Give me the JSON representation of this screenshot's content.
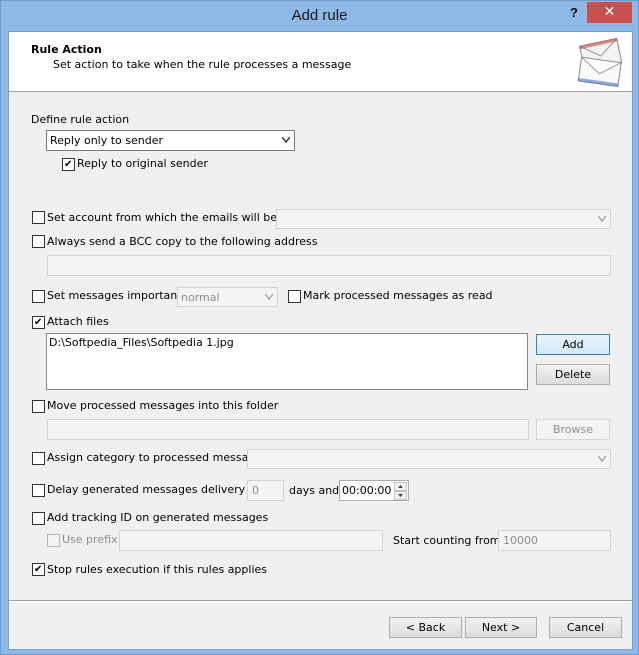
{
  "window": {
    "title": "Add rule",
    "help_label": "?",
    "close_label": "✕"
  },
  "header": {
    "title": "Rule Action",
    "subtitle": "Set action to take when the rule processes a message",
    "icon": "envelopes-icon"
  },
  "define_action": {
    "label": "Define rule action",
    "selected": "Reply only to sender",
    "reply_original": {
      "label": "Reply to original sender",
      "checked": true
    }
  },
  "set_account": {
    "label": "Set account from which the emails will be sent",
    "checked": false,
    "value": ""
  },
  "bcc": {
    "label": "Always send a BCC copy to the following address",
    "checked": false,
    "value": ""
  },
  "importance": {
    "label": "Set messages importance",
    "checked": false,
    "value": "normal"
  },
  "mark_read": {
    "label": "Mark processed messages as read",
    "checked": false
  },
  "attach": {
    "label": "Attach files",
    "checked": true,
    "files": [
      "D:\\Softpedia_Files\\Softpedia 1.jpg"
    ],
    "add_label": "Add",
    "delete_label": "Delete"
  },
  "move": {
    "label": "Move processed messages into this folder",
    "checked": false,
    "value": "",
    "browse_label": "Browse"
  },
  "category": {
    "label": "Assign category to processed messages",
    "checked": false,
    "value": ""
  },
  "delay": {
    "label": "Delay generated messages delivery with",
    "checked": false,
    "days": "0",
    "days_and_label": "days and",
    "time": "00:00:00"
  },
  "tracking": {
    "label": "Add tracking ID on generated messages",
    "checked": false,
    "use_prefix_label": "Use prefix",
    "prefix_value": "",
    "start_label": "Start counting from",
    "start_value": "10000"
  },
  "stop_rules": {
    "label": "Stop rules execution if this rules applies",
    "checked": true
  },
  "footer": {
    "back_label": "< Back",
    "next_label": "Next >",
    "cancel_label": "Cancel"
  },
  "check_glyph": "✔"
}
